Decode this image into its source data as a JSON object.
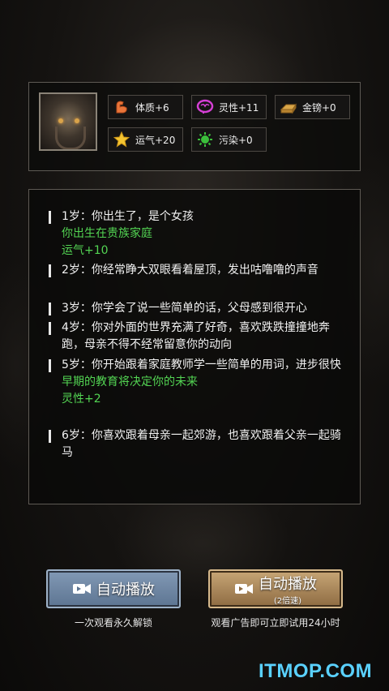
{
  "stats": {
    "physique": {
      "label": "体质+6",
      "icon": "muscle-arm-icon"
    },
    "spirit": {
      "label": "灵性+11",
      "icon": "brain-icon"
    },
    "gold": {
      "label": "金镑+0",
      "icon": "gold-bars-icon"
    },
    "luck": {
      "label": "运气+20",
      "icon": "star-icon"
    },
    "pollution": {
      "label": "污染+0",
      "icon": "virus-icon"
    }
  },
  "log": [
    {
      "text": "1岁：你出生了，是个女孩",
      "event": "你出生在贵族家庭",
      "bonus": "运气+10"
    },
    {
      "text": "2岁：你经常睁大双眼看着屋顶，发出咕噜噜的声音"
    },
    {
      "text": "3岁：你学会了说一些简单的话，父母感到很开心"
    },
    {
      "text": "4岁：你对外面的世界充满了好奇，喜欢跌跌撞撞地奔跑，母亲不得不经常留意你的动向"
    },
    {
      "text": "5岁：你开始跟着家庭教师学一些简单的用词，进步很快",
      "event": "早期的教育将决定你的未来",
      "bonus": "灵性+2"
    },
    {
      "text": "6岁：你喜欢跟着母亲一起郊游，也喜欢跟着父亲一起骑马"
    }
  ],
  "buttons": {
    "auto_play": {
      "label": "自动播放",
      "hint": "一次观看永久解锁"
    },
    "auto_play_2x": {
      "label": "自动播放",
      "sub": "(2倍速)",
      "hint": "观看广告即可立即试用24小时"
    }
  },
  "watermark": "ITMOP.COM"
}
